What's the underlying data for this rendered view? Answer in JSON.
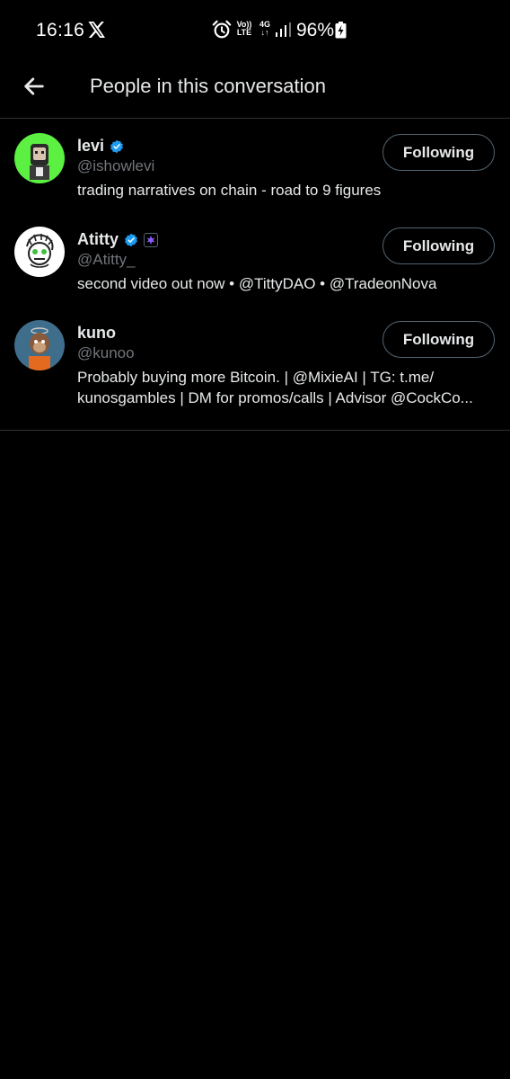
{
  "status_bar": {
    "time": "16:16",
    "volte_top": "Vo))",
    "volte_bottom": "LTE",
    "net_top": "4G",
    "net_bottom": "↓↑",
    "battery": "96%"
  },
  "header": {
    "title": "People in this conversation",
    "back_icon": "arrow-left-icon"
  },
  "people": [
    {
      "name": "levi",
      "handle": "@ishowlevi",
      "bio": "trading narratives on chain - road to 9 figures",
      "verified": true,
      "affiliate": false,
      "button": "Following"
    },
    {
      "name": "Atitty",
      "handle": "@Atitty_",
      "bio": "second video out now • @TittyDAO • @TradeonNova",
      "verified": true,
      "affiliate": true,
      "button": "Following"
    },
    {
      "name": "kuno",
      "handle": "@kunoo",
      "bio": "Probably buying more Bitcoin. | @MixieAI | TG: t.me/ kunosgambles | DM for promos/calls | Advisor @CockCo...",
      "verified": false,
      "affiliate": false,
      "button": "Following"
    }
  ],
  "colors": {
    "background": "#000000",
    "text_primary": "#e7e9ea",
    "text_secondary": "#71767b",
    "verified_blue": "#1d9bf0",
    "border": "#2f3336"
  }
}
